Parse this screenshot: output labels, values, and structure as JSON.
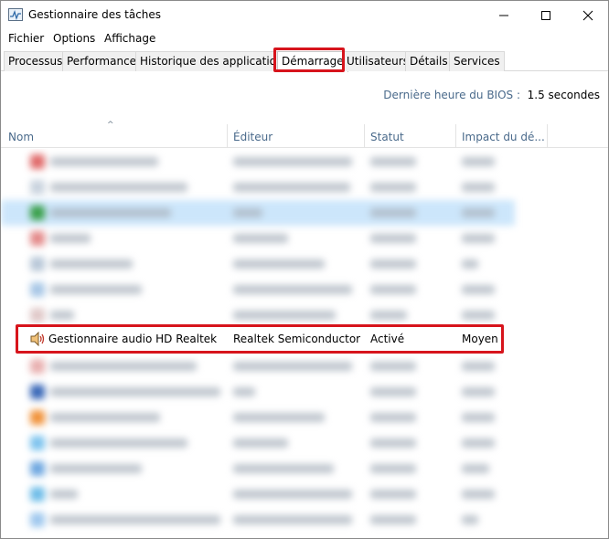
{
  "window": {
    "title": "Gestionnaire des tâches",
    "icon": "task-manager-icon"
  },
  "menu": [
    "Fichier",
    "Options",
    "Affichage"
  ],
  "tabs": [
    {
      "label": "Processus",
      "active": false
    },
    {
      "label": "Performance",
      "active": false
    },
    {
      "label": "Historique des applications",
      "active": false
    },
    {
      "label": "Démarrage",
      "active": true
    },
    {
      "label": "Utilisateurs",
      "active": false
    },
    {
      "label": "Détails",
      "active": false
    },
    {
      "label": "Services",
      "active": false
    }
  ],
  "bios": {
    "label": "Dernière heure du BIOS :",
    "value": "1.5 secondes"
  },
  "columns": {
    "name": "Nom",
    "publisher": "Éditeur",
    "status": "Statut",
    "impact": "Impact du dé..."
  },
  "highlighted_row": {
    "icon": "speaker-icon",
    "name": "Gestionnaire audio HD Realtek",
    "publisher": "Realtek Semiconductor",
    "status": "Activé",
    "impact": "Moyen"
  },
  "colors": {
    "highlight_border": "#d7141c",
    "header_text": "#4a6a8b",
    "selected_row": "#cce6fb"
  }
}
